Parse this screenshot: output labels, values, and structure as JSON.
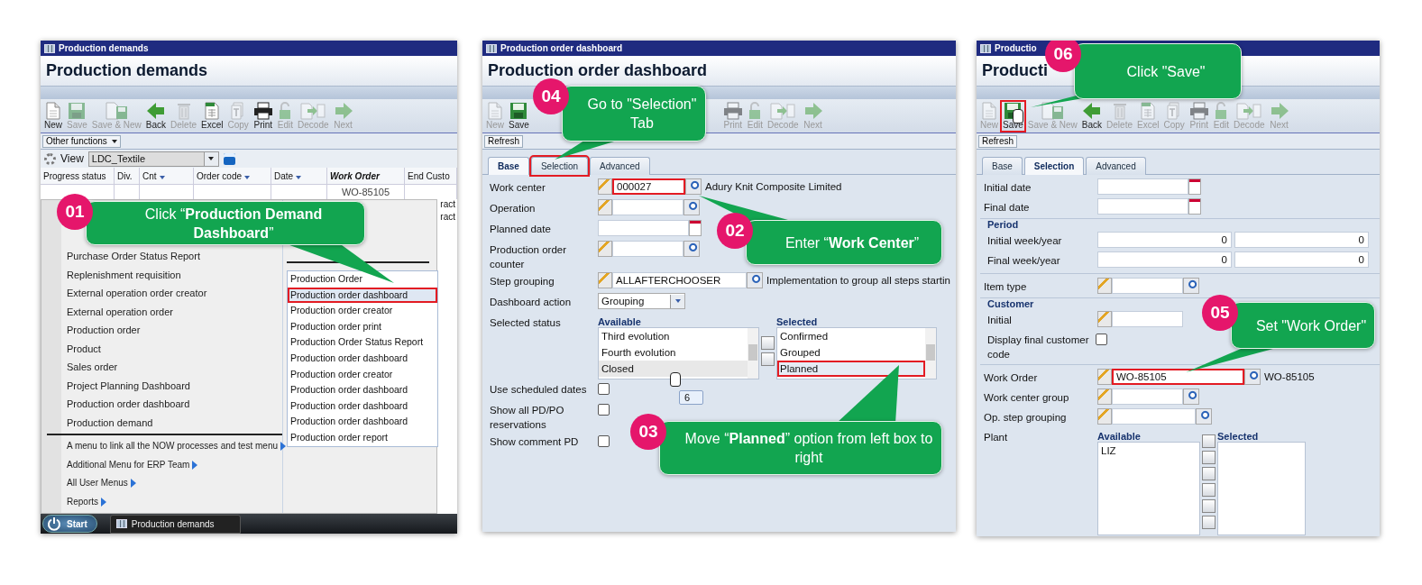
{
  "production_demands_screen": {
    "window_title": "Production demands",
    "heading": "Production demands",
    "toolbar": [
      {
        "kind": "new",
        "label": "New",
        "disabled": false
      },
      {
        "kind": "save",
        "label": "Save",
        "disabled": true
      },
      {
        "kind": "save_new",
        "label": "Save & New",
        "disabled": true
      },
      {
        "kind": "back",
        "label": "Back",
        "disabled": false
      },
      {
        "kind": "delete",
        "label": "Delete",
        "disabled": true
      },
      {
        "kind": "excel",
        "label": "Excel",
        "disabled": false
      },
      {
        "kind": "copy",
        "label": "Copy",
        "disabled": true
      },
      {
        "kind": "print",
        "label": "Print",
        "disabled": false
      },
      {
        "kind": "edit",
        "label": "Edit",
        "disabled": true
      },
      {
        "kind": "decode",
        "label": "Decode",
        "disabled": true
      },
      {
        "kind": "next",
        "label": "Next",
        "disabled": true
      }
    ],
    "other_functions": "Other functions",
    "view": {
      "label": "View",
      "value": "LDC_Textile"
    },
    "columns": [
      {
        "label": "Progress status",
        "sortable": false,
        "emphasized": false
      },
      {
        "label": "Div.",
        "sortable": false,
        "emphasized": false
      },
      {
        "label": "Cnt",
        "sortable": true,
        "emphasized": false
      },
      {
        "label": "Order code",
        "sortable": true,
        "emphasized": false
      },
      {
        "label": "Date",
        "sortable": true,
        "emphasized": false
      },
      {
        "label": "Work Order",
        "sortable": false,
        "emphasized": true,
        "filter": "WO-85105"
      },
      {
        "label": "End Custo",
        "sortable": false,
        "emphasized": false
      }
    ],
    "row_fragments": [
      "ract",
      "ract"
    ],
    "start_menu": {
      "items": [
        "Purchase Order Status Report",
        "Replenishment requisition",
        "External operation order creator",
        "External operation order",
        "Production order",
        "Product",
        "Sales order",
        "Project Planning Dashboard",
        "Production order dashboard",
        "Production demand"
      ],
      "submenus": [
        {
          "label": "A menu to link all the NOW processes and test menu",
          "has_arrow": true
        },
        {
          "label": "Additional Menu for ERP Team",
          "has_arrow": true
        },
        {
          "label": "All User Menus",
          "has_arrow": true
        },
        {
          "label": "Reports",
          "has_arrow": true
        }
      ],
      "programs": [
        {
          "label": "Production Order",
          "selected": false
        },
        {
          "label": "Production order dashboard",
          "selected": true
        },
        {
          "label": "Production order creator",
          "selected": false
        },
        {
          "label": "Production order print",
          "selected": false
        },
        {
          "label": "Production Order Status Report",
          "selected": false
        },
        {
          "label": "Production order dashboard",
          "selected": false
        },
        {
          "label": "Production order creator",
          "selected": false
        },
        {
          "label": "Production order dashboard",
          "selected": false
        },
        {
          "label": "Production order dashboard",
          "selected": false
        },
        {
          "label": "Production order dashboard",
          "selected": false
        },
        {
          "label": "Production order report",
          "selected": false
        }
      ]
    },
    "taskbar": {
      "start": "Start",
      "task": "Production demands"
    },
    "callouts": [
      {
        "badge": "01",
        "text": "Click “**Production Demand Dashboard**”"
      }
    ]
  },
  "dashboard_base_screen": {
    "window_title": "Production order dashboard",
    "heading": "Production order dashboard",
    "toolbar": [
      {
        "kind": "new",
        "label": "New",
        "disabled": true
      },
      {
        "kind": "save",
        "label": "Save",
        "disabled": false
      },
      {
        "kind": "print",
        "label": "Print",
        "disabled": true
      },
      {
        "kind": "edit",
        "label": "Edit",
        "disabled": true
      },
      {
        "kind": "decode",
        "label": "Decode",
        "disabled": true
      },
      {
        "kind": "next",
        "label": "Next",
        "disabled": true
      }
    ],
    "refresh": "Refresh",
    "tabs": [
      {
        "label": "Base",
        "selected": true,
        "highlighted": false
      },
      {
        "label": "Selection",
        "selected": false,
        "highlighted": true
      },
      {
        "label": "Advanced",
        "selected": false,
        "highlighted": false
      }
    ],
    "fields": [
      {
        "kind": "lookup",
        "label": "Work center",
        "value": "000027",
        "description": "Adury Knit Composite Limited",
        "highlighted": true
      },
      {
        "kind": "lookup",
        "label": "Operation",
        "highlighted": false
      },
      {
        "kind": "date",
        "label": "Planned date"
      },
      {
        "kind": "lookup",
        "label": "Production order counter",
        "highlighted": false
      },
      {
        "kind": "lookup",
        "label": "Step grouping",
        "value": "ALLAFTERCHOOSER",
        "description": "Implementation to group all steps startin",
        "highlighted": false
      },
      {
        "kind": "select",
        "label": "Dashboard action",
        "value": "Grouping"
      },
      {
        "kind": "dual_list",
        "label": "Selected status",
        "available_title": "Available",
        "selected_title": "Selected",
        "available": [
          {
            "label": "Third evolution",
            "hovered": false
          },
          {
            "label": "Fourth evolution",
            "hovered": false
          },
          {
            "label": "Closed",
            "hovered": true
          }
        ],
        "selected": [
          {
            "label": "Confirmed",
            "selected": false
          },
          {
            "label": "Grouped",
            "selected": false
          },
          {
            "label": "Planned",
            "selected": true
          }
        ],
        "tooltip": "6"
      },
      {
        "kind": "checkbox",
        "label": "Use scheduled dates",
        "checked": false
      },
      {
        "kind": "checkbox",
        "label": "Show all PD/PO reservations",
        "checked": false
      },
      {
        "kind": "checkbox",
        "label": "Show comment PD",
        "checked": false
      }
    ],
    "callouts": [
      {
        "badge": "04",
        "text": "Go to \"Selection\" Tab"
      },
      {
        "badge": "02",
        "text": "Enter “**Work Center**”"
      },
      {
        "badge": "03",
        "text": "Move “**Planned**” option from left box to right"
      }
    ]
  },
  "dashboard_selection_screen": {
    "window_title": "Productio",
    "heading": "Producti",
    "toolbar": [
      {
        "kind": "new",
        "label": "New",
        "disabled": true,
        "highlighted": false
      },
      {
        "kind": "save",
        "label": "Save",
        "disabled": false,
        "highlighted": true
      },
      {
        "kind": "save_new",
        "label": "Save & New",
        "disabled": true,
        "highlighted": false
      },
      {
        "kind": "back",
        "label": "Back",
        "disabled": false,
        "highlighted": false
      },
      {
        "kind": "delete",
        "label": "Delete",
        "disabled": true,
        "highlighted": false
      },
      {
        "kind": "excel",
        "label": "Excel",
        "disabled": true,
        "highlighted": false
      },
      {
        "kind": "copy",
        "label": "Copy",
        "disabled": true,
        "highlighted": false
      },
      {
        "kind": "print",
        "label": "Print",
        "disabled": true,
        "highlighted": false
      },
      {
        "kind": "edit",
        "label": "Edit",
        "disabled": true,
        "highlighted": false
      },
      {
        "kind": "decode",
        "label": "Decode",
        "disabled": true,
        "highlighted": false
      },
      {
        "kind": "next",
        "label": "Next",
        "disabled": true,
        "highlighted": false
      }
    ],
    "refresh": "Refresh",
    "tabs": [
      {
        "label": "Base",
        "selected": false,
        "highlighted": false
      },
      {
        "label": "Selection",
        "selected": true,
        "highlighted": false
      },
      {
        "label": "Advanced",
        "selected": false,
        "highlighted": false
      }
    ],
    "fields": [
      {
        "kind": "date",
        "label": "Initial date"
      },
      {
        "kind": "date",
        "label": "Final date"
      },
      {
        "kind": "group",
        "title": "Period",
        "rows": [
          {
            "kind": "pair",
            "label": "Initial week/year",
            "values": [
              "0",
              "0"
            ]
          },
          {
            "kind": "pair",
            "label": "Final week/year",
            "values": [
              "0",
              "0"
            ]
          }
        ]
      },
      {
        "kind": "lookup",
        "label": "Item type",
        "highlighted": false
      },
      {
        "kind": "group",
        "title": "Customer",
        "rows": [
          {
            "kind": "lookup",
            "label": "Initial",
            "highlighted": false
          },
          {
            "kind": "checkbox",
            "label": "Display final customer code",
            "checked": false
          }
        ]
      },
      {
        "kind": "lookup",
        "label": "Work Order",
        "value": "WO-85105",
        "description": "WO-85105",
        "highlighted": true
      },
      {
        "kind": "lookup",
        "label": "Work center group",
        "highlighted": false
      },
      {
        "kind": "lookup",
        "label": "Op. step grouping",
        "highlighted": false
      },
      {
        "kind": "dual_list",
        "label": "Plant",
        "available_title": "Available",
        "selected_title": "Selected",
        "available": [
          {
            "label": "LIZ",
            "hovered": false
          }
        ]
      }
    ],
    "callouts": [
      {
        "badge": "06",
        "text": "Click \"Save\""
      },
      {
        "badge": "05",
        "text": "Set \"Work Order\""
      }
    ]
  }
}
